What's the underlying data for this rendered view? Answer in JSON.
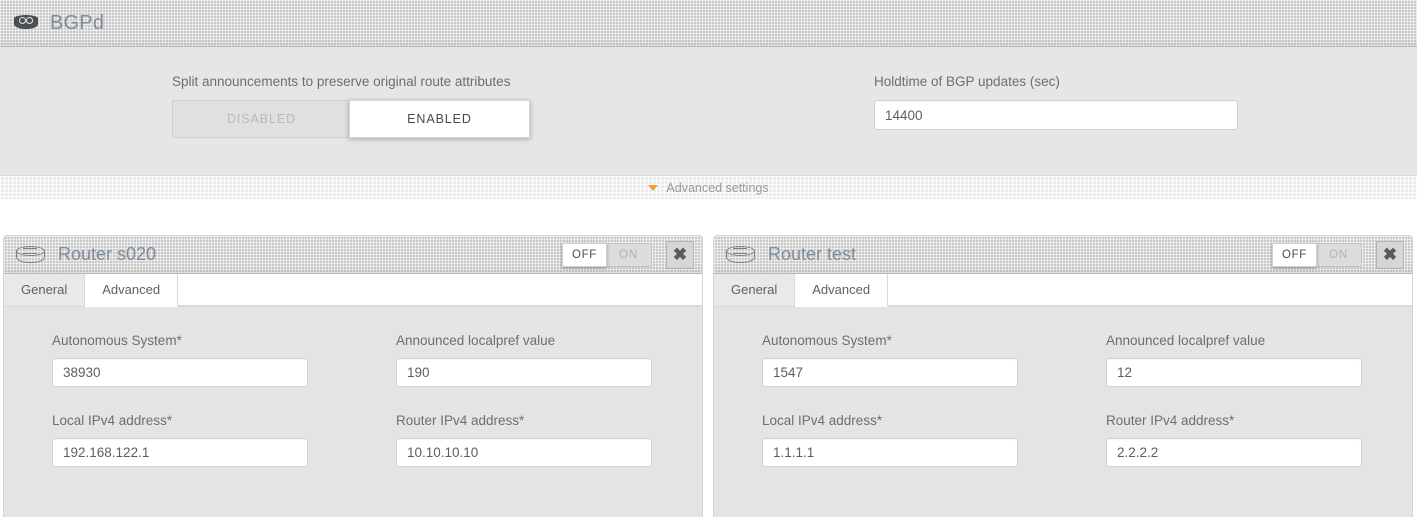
{
  "bgpd": {
    "icon": "router-solid-icon",
    "title": "BGPd",
    "split": {
      "label": "Split announcements to preserve original route attributes",
      "options": [
        "DISABLED",
        "ENABLED"
      ],
      "selected": "ENABLED"
    },
    "holdtime": {
      "label": "Holdtime of BGP updates (sec)",
      "value": "14400",
      "placeholder": ""
    },
    "advanced": {
      "caret_icon": "caret-down-icon",
      "label": "Advanced settings",
      "caret_color": "#f0a030"
    }
  },
  "panels": [
    {
      "icon": "router-outline-icon",
      "title": "Router s020",
      "power": {
        "options": [
          "OFF",
          "ON"
        ],
        "selected": "OFF"
      },
      "close_icon": "close-icon",
      "close_label": "✖",
      "tabs": [
        {
          "label": "General",
          "active": false
        },
        {
          "label": "Advanced",
          "active": true
        }
      ],
      "fields": [
        {
          "label": "Autonomous System*",
          "value": "38930",
          "placeholder": ""
        },
        {
          "label": "Announced localpref value",
          "value": "190",
          "placeholder": ""
        },
        {
          "label": "Local IPv4 address*",
          "value": "192.168.122.1",
          "placeholder": ""
        },
        {
          "label": "Router IPv4 address*",
          "value": "10.10.10.10",
          "placeholder": ""
        }
      ]
    },
    {
      "icon": "router-outline-icon",
      "title": "Router test",
      "power": {
        "options": [
          "OFF",
          "ON"
        ],
        "selected": "OFF"
      },
      "close_icon": "close-icon",
      "close_label": "✖",
      "tabs": [
        {
          "label": "General",
          "active": false
        },
        {
          "label": "Advanced",
          "active": true
        }
      ],
      "fields": [
        {
          "label": "Autonomous System*",
          "value": "1547",
          "placeholder": ""
        },
        {
          "label": "Announced localpref value",
          "value": "12",
          "placeholder": ""
        },
        {
          "label": "Local IPv4 address*",
          "value": "1.1.1.1",
          "placeholder": ""
        },
        {
          "label": "Router IPv4 address*",
          "value": "2.2.2.2",
          "placeholder": ""
        }
      ]
    }
  ],
  "theme": {
    "header_bg": "#c9c9c9",
    "body_bg": "#e6e6e6",
    "title_color": "#7f8c9a",
    "accent": "#f0a030"
  }
}
